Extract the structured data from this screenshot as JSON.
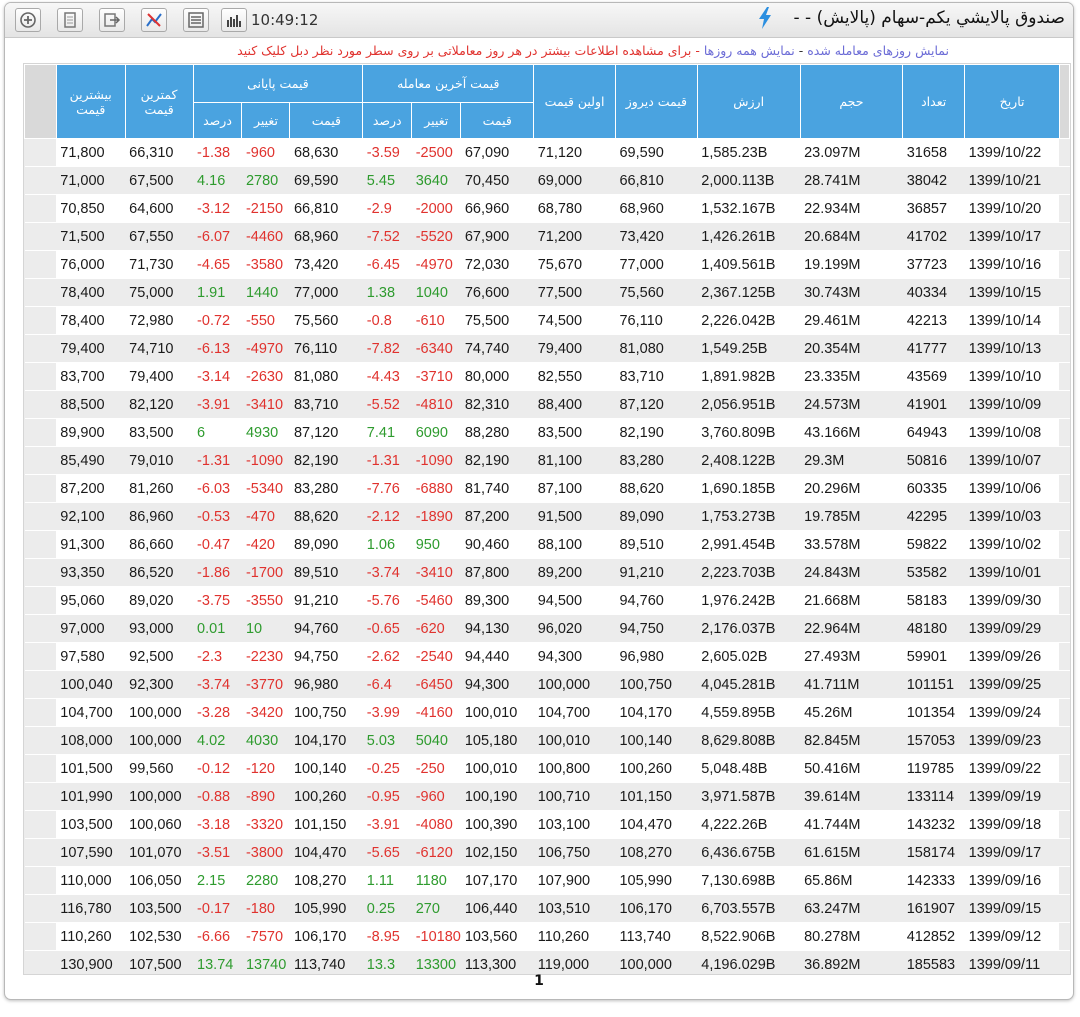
{
  "titlebar": {
    "time": "10:49:12",
    "title": "صندوق پالايشي يكم-سهام (پالايش) - -",
    "buttons": [
      "add-icon",
      "document-icon",
      "export-icon",
      "chart-arrow-icon",
      "list-icon",
      "bar-chart-icon"
    ]
  },
  "infobar": {
    "link_traded": "نمایش روزهای معامله شده",
    "sep": " - ",
    "link_all": "نمایش همه روزها",
    "hint": " - برای مشاهده اطلاعات بیشتر در هر روز معاملاتی بر روی سطر مورد نظر دبل کلیک کنید"
  },
  "colors": {
    "header_blue": "#4aa3e0",
    "positive": "#2e9b2e",
    "negative": "#e0322e",
    "link": "#6b6bd6"
  },
  "headers": {
    "max": "بیشترین قیمت",
    "min": "کمترین قیمت",
    "close_group": "قیمت پایانی",
    "last_group": "قیمت آخرین معامله",
    "first": "اولین قیمت",
    "yesterday": "قیمت دیروز",
    "value": "ارزش",
    "volume": "حجم",
    "count": "تعداد",
    "date": "تاریخ",
    "percent": "درصد",
    "change": "تغییر",
    "price": "قیمت"
  },
  "rows": [
    {
      "max": "71,800",
      "min": "66,310",
      "cpct": "-1.38",
      "cchg": "-960",
      "cprice": "68,630",
      "lpct": "-3.59",
      "lchg": "-2500",
      "lprice": "67,090",
      "first": "71,120",
      "yest": "69,590",
      "value": "1,585.23B",
      "vol": "23.097M",
      "count": "31658",
      "date": "1399/10/22"
    },
    {
      "max": "71,000",
      "min": "67,500",
      "cpct": "4.16",
      "cchg": "2780",
      "cprice": "69,590",
      "lpct": "5.45",
      "lchg": "3640",
      "lprice": "70,450",
      "first": "69,000",
      "yest": "66,810",
      "value": "2,000.113B",
      "vol": "28.741M",
      "count": "38042",
      "date": "1399/10/21"
    },
    {
      "max": "70,850",
      "min": "64,600",
      "cpct": "-3.12",
      "cchg": "-2150",
      "cprice": "66,810",
      "lpct": "-2.9",
      "lchg": "-2000",
      "lprice": "66,960",
      "first": "68,780",
      "yest": "68,960",
      "value": "1,532.167B",
      "vol": "22.934M",
      "count": "36857",
      "date": "1399/10/20"
    },
    {
      "max": "71,500",
      "min": "67,550",
      "cpct": "-6.07",
      "cchg": "-4460",
      "cprice": "68,960",
      "lpct": "-7.52",
      "lchg": "-5520",
      "lprice": "67,900",
      "first": "71,200",
      "yest": "73,420",
      "value": "1,426.261B",
      "vol": "20.684M",
      "count": "41702",
      "date": "1399/10/17"
    },
    {
      "max": "76,000",
      "min": "71,730",
      "cpct": "-4.65",
      "cchg": "-3580",
      "cprice": "73,420",
      "lpct": "-6.45",
      "lchg": "-4970",
      "lprice": "72,030",
      "first": "75,670",
      "yest": "77,000",
      "value": "1,409.561B",
      "vol": "19.199M",
      "count": "37723",
      "date": "1399/10/16"
    },
    {
      "max": "78,400",
      "min": "75,000",
      "cpct": "1.91",
      "cchg": "1440",
      "cprice": "77,000",
      "lpct": "1.38",
      "lchg": "1040",
      "lprice": "76,600",
      "first": "77,500",
      "yest": "75,560",
      "value": "2,367.125B",
      "vol": "30.743M",
      "count": "40334",
      "date": "1399/10/15"
    },
    {
      "max": "78,400",
      "min": "72,980",
      "cpct": "-0.72",
      "cchg": "-550",
      "cprice": "75,560",
      "lpct": "-0.8",
      "lchg": "-610",
      "lprice": "75,500",
      "first": "74,500",
      "yest": "76,110",
      "value": "2,226.042B",
      "vol": "29.461M",
      "count": "42213",
      "date": "1399/10/14"
    },
    {
      "max": "79,400",
      "min": "74,710",
      "cpct": "-6.13",
      "cchg": "-4970",
      "cprice": "76,110",
      "lpct": "-7.82",
      "lchg": "-6340",
      "lprice": "74,740",
      "first": "79,400",
      "yest": "81,080",
      "value": "1,549.25B",
      "vol": "20.354M",
      "count": "41777",
      "date": "1399/10/13"
    },
    {
      "max": "83,700",
      "min": "79,400",
      "cpct": "-3.14",
      "cchg": "-2630",
      "cprice": "81,080",
      "lpct": "-4.43",
      "lchg": "-3710",
      "lprice": "80,000",
      "first": "82,550",
      "yest": "83,710",
      "value": "1,891.982B",
      "vol": "23.335M",
      "count": "43569",
      "date": "1399/10/10"
    },
    {
      "max": "88,500",
      "min": "82,120",
      "cpct": "-3.91",
      "cchg": "-3410",
      "cprice": "83,710",
      "lpct": "-5.52",
      "lchg": "-4810",
      "lprice": "82,310",
      "first": "88,400",
      "yest": "87,120",
      "value": "2,056.951B",
      "vol": "24.573M",
      "count": "41901",
      "date": "1399/10/09"
    },
    {
      "max": "89,900",
      "min": "83,500",
      "cpct": "6",
      "cchg": "4930",
      "cprice": "87,120",
      "lpct": "7.41",
      "lchg": "6090",
      "lprice": "88,280",
      "first": "83,500",
      "yest": "82,190",
      "value": "3,760.809B",
      "vol": "43.166M",
      "count": "64943",
      "date": "1399/10/08"
    },
    {
      "max": "85,490",
      "min": "79,010",
      "cpct": "-1.31",
      "cchg": "-1090",
      "cprice": "82,190",
      "lpct": "-1.31",
      "lchg": "-1090",
      "lprice": "82,190",
      "first": "81,100",
      "yest": "83,280",
      "value": "2,408.122B",
      "vol": "29.3M",
      "count": "50816",
      "date": "1399/10/07"
    },
    {
      "max": "87,200",
      "min": "81,260",
      "cpct": "-6.03",
      "cchg": "-5340",
      "cprice": "83,280",
      "lpct": "-7.76",
      "lchg": "-6880",
      "lprice": "81,740",
      "first": "87,100",
      "yest": "88,620",
      "value": "1,690.185B",
      "vol": "20.296M",
      "count": "60335",
      "date": "1399/10/06"
    },
    {
      "max": "92,100",
      "min": "86,960",
      "cpct": "-0.53",
      "cchg": "-470",
      "cprice": "88,620",
      "lpct": "-2.12",
      "lchg": "-1890",
      "lprice": "87,200",
      "first": "91,500",
      "yest": "89,090",
      "value": "1,753.273B",
      "vol": "19.785M",
      "count": "42295",
      "date": "1399/10/03"
    },
    {
      "max": "91,300",
      "min": "86,660",
      "cpct": "-0.47",
      "cchg": "-420",
      "cprice": "89,090",
      "lpct": "1.06",
      "lchg": "950",
      "lprice": "90,460",
      "first": "88,100",
      "yest": "89,510",
      "value": "2,991.454B",
      "vol": "33.578M",
      "count": "59822",
      "date": "1399/10/02"
    },
    {
      "max": "93,350",
      "min": "86,520",
      "cpct": "-1.86",
      "cchg": "-1700",
      "cprice": "89,510",
      "lpct": "-3.74",
      "lchg": "-3410",
      "lprice": "87,800",
      "first": "89,200",
      "yest": "91,210",
      "value": "2,223.703B",
      "vol": "24.843M",
      "count": "53582",
      "date": "1399/10/01"
    },
    {
      "max": "95,060",
      "min": "89,020",
      "cpct": "-3.75",
      "cchg": "-3550",
      "cprice": "91,210",
      "lpct": "-5.76",
      "lchg": "-5460",
      "lprice": "89,300",
      "first": "94,500",
      "yest": "94,760",
      "value": "1,976.242B",
      "vol": "21.668M",
      "count": "58183",
      "date": "1399/09/30"
    },
    {
      "max": "97,000",
      "min": "93,000",
      "cpct": "0.01",
      "cchg": "10",
      "cprice": "94,760",
      "lpct": "-0.65",
      "lchg": "-620",
      "lprice": "94,130",
      "first": "96,020",
      "yest": "94,750",
      "value": "2,176.037B",
      "vol": "22.964M",
      "count": "48180",
      "date": "1399/09/29"
    },
    {
      "max": "97,580",
      "min": "92,500",
      "cpct": "-2.3",
      "cchg": "-2230",
      "cprice": "94,750",
      "lpct": "-2.62",
      "lchg": "-2540",
      "lprice": "94,440",
      "first": "94,300",
      "yest": "96,980",
      "value": "2,605.02B",
      "vol": "27.493M",
      "count": "59901",
      "date": "1399/09/26"
    },
    {
      "max": "100,040",
      "min": "92,300",
      "cpct": "-3.74",
      "cchg": "-3770",
      "cprice": "96,980",
      "lpct": "-6.4",
      "lchg": "-6450",
      "lprice": "94,300",
      "first": "100,000",
      "yest": "100,750",
      "value": "4,045.281B",
      "vol": "41.711M",
      "count": "101151",
      "date": "1399/09/25"
    },
    {
      "max": "104,700",
      "min": "100,000",
      "cpct": "-3.28",
      "cchg": "-3420",
      "cprice": "100,750",
      "lpct": "-3.99",
      "lchg": "-4160",
      "lprice": "100,010",
      "first": "104,700",
      "yest": "104,170",
      "value": "4,559.895B",
      "vol": "45.26M",
      "count": "101354",
      "date": "1399/09/24"
    },
    {
      "max": "108,000",
      "min": "100,000",
      "cpct": "4.02",
      "cchg": "4030",
      "cprice": "104,170",
      "lpct": "5.03",
      "lchg": "5040",
      "lprice": "105,180",
      "first": "100,010",
      "yest": "100,140",
      "value": "8,629.808B",
      "vol": "82.845M",
      "count": "157053",
      "date": "1399/09/23"
    },
    {
      "max": "101,500",
      "min": "99,560",
      "cpct": "-0.12",
      "cchg": "-120",
      "cprice": "100,140",
      "lpct": "-0.25",
      "lchg": "-250",
      "lprice": "100,010",
      "first": "100,800",
      "yest": "100,260",
      "value": "5,048.48B",
      "vol": "50.416M",
      "count": "119785",
      "date": "1399/09/22"
    },
    {
      "max": "101,990",
      "min": "100,000",
      "cpct": "-0.88",
      "cchg": "-890",
      "cprice": "100,260",
      "lpct": "-0.95",
      "lchg": "-960",
      "lprice": "100,190",
      "first": "100,710",
      "yest": "101,150",
      "value": "3,971.587B",
      "vol": "39.614M",
      "count": "133114",
      "date": "1399/09/19"
    },
    {
      "max": "103,500",
      "min": "100,060",
      "cpct": "-3.18",
      "cchg": "-3320",
      "cprice": "101,150",
      "lpct": "-3.91",
      "lchg": "-4080",
      "lprice": "100,390",
      "first": "103,100",
      "yest": "104,470",
      "value": "4,222.26B",
      "vol": "41.744M",
      "count": "143232",
      "date": "1399/09/18"
    },
    {
      "max": "107,590",
      "min": "101,070",
      "cpct": "-3.51",
      "cchg": "-3800",
      "cprice": "104,470",
      "lpct": "-5.65",
      "lchg": "-6120",
      "lprice": "102,150",
      "first": "106,750",
      "yest": "108,270",
      "value": "6,436.675B",
      "vol": "61.615M",
      "count": "158174",
      "date": "1399/09/17"
    },
    {
      "max": "110,000",
      "min": "106,050",
      "cpct": "2.15",
      "cchg": "2280",
      "cprice": "108,270",
      "lpct": "1.11",
      "lchg": "1180",
      "lprice": "107,170",
      "first": "107,900",
      "yest": "105,990",
      "value": "7,130.698B",
      "vol": "65.86M",
      "count": "142333",
      "date": "1399/09/16"
    },
    {
      "max": "116,780",
      "min": "103,500",
      "cpct": "-0.17",
      "cchg": "-180",
      "cprice": "105,990",
      "lpct": "0.25",
      "lchg": "270",
      "lprice": "106,440",
      "first": "103,510",
      "yest": "106,170",
      "value": "6,703.557B",
      "vol": "63.247M",
      "count": "161907",
      "date": "1399/09/15"
    },
    {
      "max": "110,260",
      "min": "102,530",
      "cpct": "-6.66",
      "cchg": "-7570",
      "cprice": "106,170",
      "lpct": "-8.95",
      "lchg": "-10180",
      "lprice": "103,560",
      "first": "110,260",
      "yest": "113,740",
      "value": "8,522.906B",
      "vol": "80.278M",
      "count": "412852",
      "date": "1399/09/12"
    },
    {
      "max": "130,900",
      "min": "107,500",
      "cpct": "13.74",
      "cchg": "13740",
      "cprice": "113,740",
      "lpct": "13.3",
      "lchg": "13300",
      "lprice": "113,300",
      "first": "119,000",
      "yest": "100,000",
      "value": "4,196.029B",
      "vol": "36.892M",
      "count": "185583",
      "date": "1399/09/11"
    }
  ],
  "pager": {
    "page": "1"
  }
}
